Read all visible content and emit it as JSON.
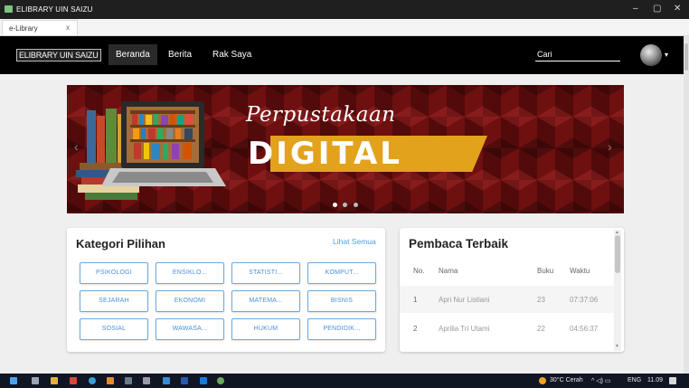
{
  "window": {
    "title": "ELIBRARY UIN SAIZU",
    "controls": {
      "minimize": "–",
      "maximize": "▢",
      "close": "✕"
    }
  },
  "browser": {
    "tab_label": "e-Library",
    "tab_close": "x"
  },
  "nav": {
    "brand": "ELIBRARY UIN SAIZU",
    "links": [
      "Beranda",
      "Berita",
      "Rak Saya"
    ],
    "active": "Beranda",
    "search_placeholder": "Cari",
    "avatar_icon": "user-avatar",
    "caret": "▾"
  },
  "banner": {
    "script_text": "Perpustakaan",
    "big_text": "DIGITAL",
    "slides_count": 3,
    "active_slide": 1,
    "prev_arrow": "‹",
    "next_arrow": "›"
  },
  "kategori": {
    "title": "Kategori Pilihan",
    "see_all": "Lihat Semua",
    "items": [
      "PSIKOLOGI",
      "ENSIKLO...",
      "STATISTI...",
      "KOMPUT...",
      "SEJARAH",
      "EKONOMI",
      "MATEMA...",
      "BISNIS",
      "SOSIAL",
      "WAWASA...",
      "HUKUM",
      "PENDIDIK..."
    ]
  },
  "pembaca": {
    "title": "Pembaca Terbaik",
    "headers": [
      "No.",
      "Nama",
      "Buku",
      "Waktu"
    ],
    "rows": [
      [
        "1",
        "Apri Nur Listiani",
        "23",
        "07:37:06"
      ],
      [
        "2",
        "Aprilia Tri Utami",
        "22",
        "04:56:37"
      ]
    ]
  },
  "taskbar": {
    "weather": "30°C  Cerah",
    "tray_symbols": "^  ◁)  ▭",
    "lang": "ENG",
    "time": "11.09"
  },
  "colors": {
    "accent_blue": "#4a90d9",
    "banner_red": "#6e1010",
    "banner_gold": "#e3a21b",
    "navbar": "#000000"
  }
}
